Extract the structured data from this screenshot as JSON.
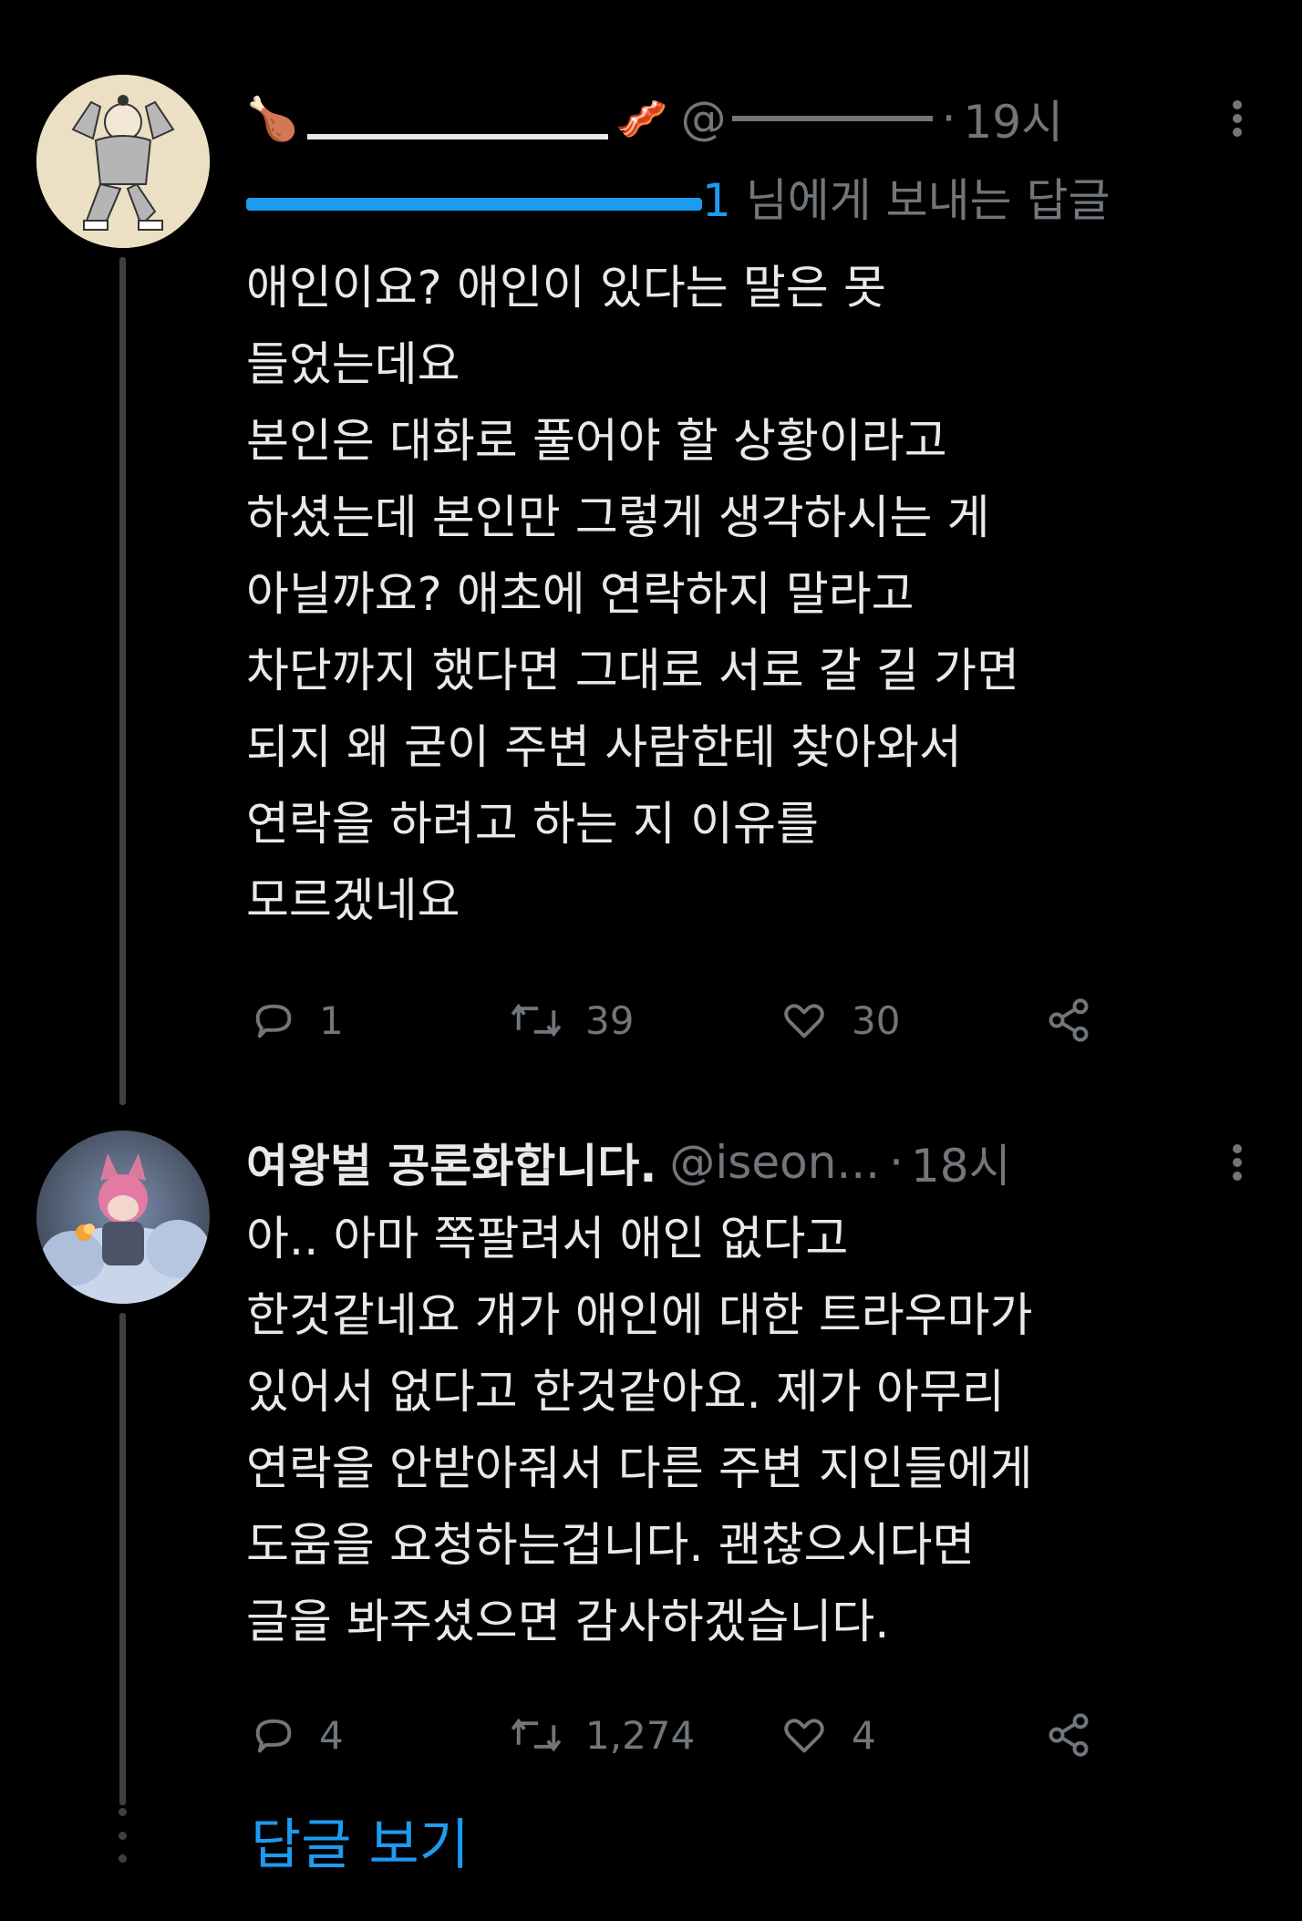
{
  "tweets": [
    {
      "display_name": " ",
      "handle": "@",
      "time": "19시",
      "reply_to_prefix": "",
      "reply_to_mention": "1",
      "reply_to_suffix": " 님에게 보내는 답글",
      "lines": [
        "애인이요? 애인이 있다는 말은 못",
        "들었는데요",
        "본인은 대화로 풀어야 할 상황이라고",
        "하셨는데 본인만 그렇게 생각하시는 게",
        "아닐까요? 애초에 연락하지 말라고",
        "차단까지 했다면 그대로 서로 갈 길 가면",
        "되지 왜 굳이 주변 사람한테 찾아와서",
        "연락을 하려고 하는 지 이유를",
        "모르겠네요"
      ],
      "replies": "1",
      "retweets": "39",
      "likes": "30"
    },
    {
      "display_name": "여왕벌 공론화합니다.",
      "handle": "@iseon...",
      "time": "18시",
      "lines": [
        "아.. 아마 쪽팔려서 애인 없다고",
        "한것같네요 걔가 애인에 대한 트라우마가",
        "있어서 없다고 한것같아요. 제가 아무리",
        "연락을 안받아줘서 다른 주변 지인들에게",
        "도움을 요청하는겁니다. 괜찮으시다면",
        "글을 봐주셨으면 감사하겠습니다."
      ],
      "replies": "4",
      "retweets": "1,274",
      "likes": "4"
    }
  ],
  "show_replies_label": "답글 보기",
  "colors": {
    "background": "#000000",
    "text": "#e7e9ea",
    "secondary": "#71767b",
    "accent": "#1d9bf0"
  }
}
